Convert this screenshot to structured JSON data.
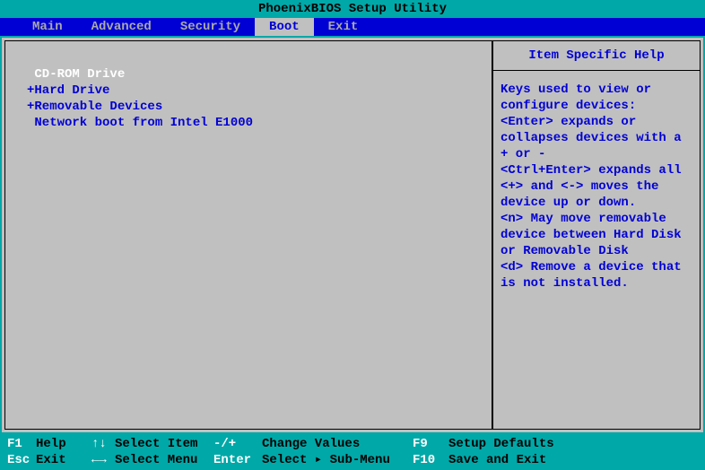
{
  "title": "PhoenixBIOS Setup Utility",
  "tabs": {
    "main": "Main",
    "advanced": "Advanced",
    "security": "Security",
    "boot": "Boot",
    "exit": "Exit"
  },
  "boot_list": {
    "item0": " CD-ROM Drive",
    "item1": "+Hard Drive",
    "item2": "+Removable Devices",
    "item3": " Network boot from Intel E1000"
  },
  "help": {
    "title": "Item Specific Help",
    "body": "Keys used to view or configure devices:\n<Enter> expands or collapses devices with a + or -\n<Ctrl+Enter> expands all\n<+> and <-> moves the device up or down.\n<n> May move removable device between Hard Disk or Removable Disk\n<d> Remove a device that is not installed."
  },
  "footer": {
    "r1": {
      "k1": "F1",
      "l1": "Help",
      "a1": "↑↓",
      "ac1": "Select Item",
      "k2": "-/+",
      "ac2": "Change Values",
      "k3": "F9",
      "ac3": "Setup Defaults"
    },
    "r2": {
      "k1": "Esc",
      "l1": "Exit",
      "a1": "←→",
      "ac1": "Select Menu",
      "k2": "Enter",
      "ac2": "Select ▸ Sub-Menu",
      "k3": "F10",
      "ac3": "Save and Exit"
    }
  }
}
